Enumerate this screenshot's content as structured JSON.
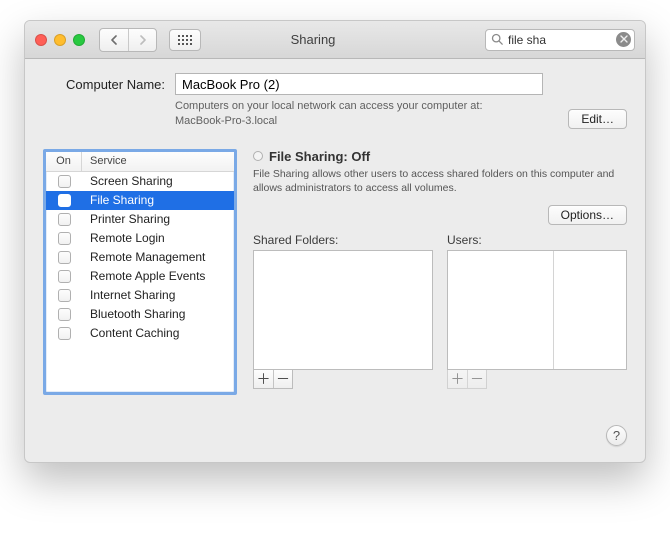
{
  "window": {
    "title": "Sharing"
  },
  "search": {
    "value": "file sha"
  },
  "computer_name": {
    "label": "Computer Name:",
    "value": "MacBook Pro (2)",
    "desc_line1": "Computers on your local network can access your computer at:",
    "desc_line2": "MacBook-Pro-3.local",
    "edit_label": "Edit…"
  },
  "service_table": {
    "col_on": "On",
    "col_service": "Service",
    "rows": [
      {
        "label": "Screen Sharing",
        "checked": false,
        "selected": false
      },
      {
        "label": "File Sharing",
        "checked": false,
        "selected": true
      },
      {
        "label": "Printer Sharing",
        "checked": false,
        "selected": false
      },
      {
        "label": "Remote Login",
        "checked": false,
        "selected": false
      },
      {
        "label": "Remote Management",
        "checked": false,
        "selected": false
      },
      {
        "label": "Remote Apple Events",
        "checked": false,
        "selected": false
      },
      {
        "label": "Internet Sharing",
        "checked": false,
        "selected": false
      },
      {
        "label": "Bluetooth Sharing",
        "checked": false,
        "selected": false
      },
      {
        "label": "Content Caching",
        "checked": false,
        "selected": false
      }
    ]
  },
  "detail": {
    "status_title": "File Sharing: Off",
    "status_desc": "File Sharing allows other users to access shared folders on this computer and allows administrators to access all volumes.",
    "options_label": "Options…",
    "shared_folders_label": "Shared Folders:",
    "users_label": "Users:",
    "plus": "＋",
    "minus": "－"
  },
  "help": {
    "label": "?"
  },
  "colors": {
    "selection": "#1f6fe5",
    "focus_ring": "#7aa9e6"
  }
}
